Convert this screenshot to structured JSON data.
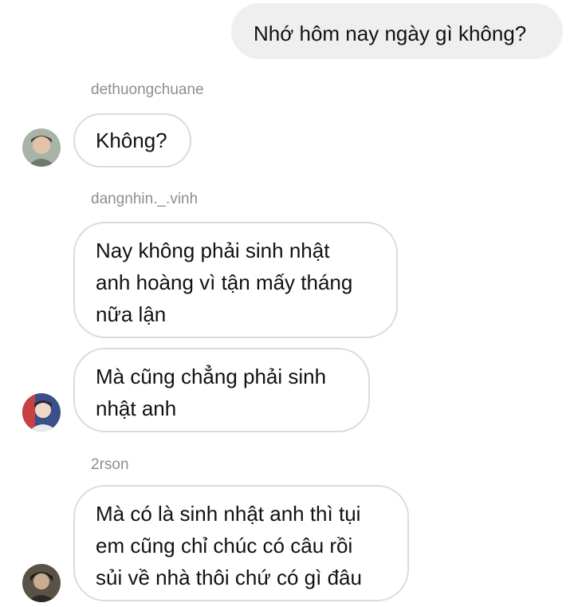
{
  "thread": {
    "outgoing": {
      "text": "Nhớ hôm nay ngày gì không?"
    },
    "groups": [
      {
        "username": "dethuongchuane",
        "messages": [
          {
            "lines": [
              "Không?"
            ]
          }
        ],
        "avatar_icon": "user-avatar-icon"
      },
      {
        "username": "dangnhin._.vinh",
        "messages": [
          {
            "lines": [
              "Nay không phải sinh nhật",
              "anh hoàng vì tận mấy tháng",
              "nữa lận"
            ]
          },
          {
            "lines": [
              "Mà cũng chẳng phải sinh",
              "nhật anh"
            ]
          }
        ],
        "avatar_icon": "user-avatar-icon"
      },
      {
        "username": "2rson",
        "messages": [
          {
            "lines": [
              "Mà có là sinh nhật anh thì tụi",
              "em cũng chỉ chúc có câu rồi",
              "sủi về nhà thôi chứ có gì đâu"
            ]
          }
        ],
        "avatar_icon": "user-avatar-icon"
      }
    ]
  },
  "colors": {
    "outgoing_bubble": "#efefef",
    "incoming_border": "#dbdbdb",
    "username": "#8e8e8e",
    "text": "#111111"
  }
}
